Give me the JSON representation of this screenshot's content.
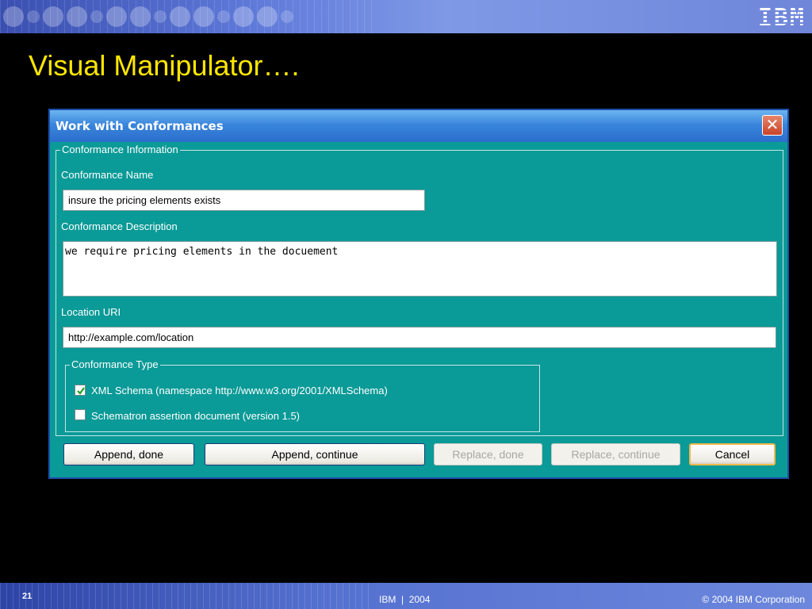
{
  "header": {
    "logo_text": "IBM"
  },
  "slide": {
    "title": "Visual Manipulator….",
    "number": "21",
    "footer_center": "IBM  |  2004",
    "footer_right": "© 2004 IBM Corporation"
  },
  "dialog": {
    "title": "Work with Conformances",
    "close_glyph": "✕",
    "info_group": {
      "legend": "Conformance Information",
      "name_label": "Conformance Name",
      "name_value": "insure the pricing elements exists",
      "description_label": "Conformance Description",
      "description_value": "we require pricing elements in the docuement",
      "location_label": "Location URI",
      "location_value": "http://example.com/location"
    },
    "type_group": {
      "legend": "Conformance Type",
      "options": [
        {
          "label": "XML Schema (namespace http://www.w3.org/2001/XMLSchema)",
          "checked": true
        },
        {
          "label": "Schematron assertion document (version 1.5)",
          "checked": false
        }
      ]
    },
    "buttons": {
      "append_done": "Append, done",
      "append_continue": "Append, continue",
      "replace_done": "Replace, done",
      "replace_continue": "Replace, continue",
      "cancel": "Cancel"
    }
  },
  "colors": {
    "dialog_bg": "#0a9a97",
    "title_yellow": "#ffe600",
    "titlebar_blue": "#2a6dcc",
    "checkmark_green": "#21a121"
  }
}
